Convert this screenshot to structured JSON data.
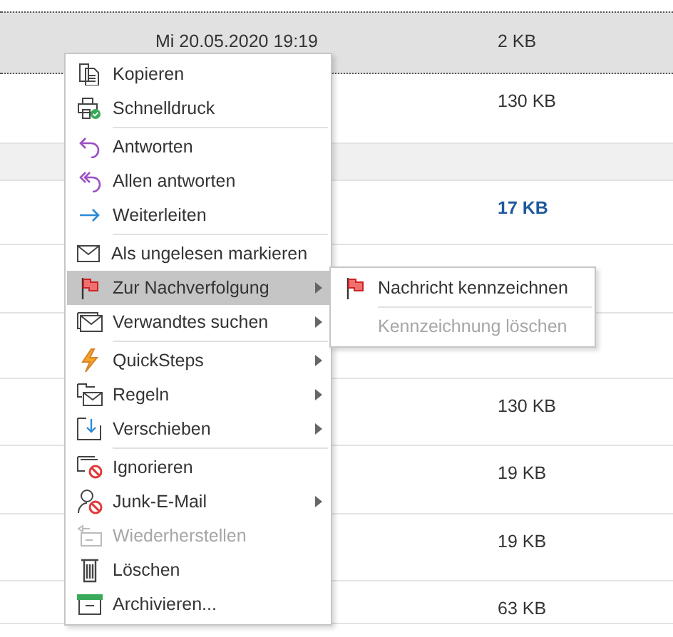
{
  "mail_list": {
    "rows": [
      {
        "date": "Mi 20.05.2020 19:19",
        "size": "2 KB",
        "kind": "selected"
      },
      {
        "size": "130 KB",
        "kind": "mail"
      },
      {
        "kind": "group"
      },
      {
        "size": "17 KB",
        "kind": "unread"
      },
      {
        "kind": "mail"
      },
      {
        "kind": "mail"
      },
      {
        "size": "130 KB",
        "kind": "mail"
      },
      {
        "size": "19 KB",
        "kind": "mail"
      },
      {
        "size": "19 KB",
        "kind": "mail"
      },
      {
        "size": "63 KB",
        "kind": "mail"
      }
    ]
  },
  "context_menu": {
    "items": [
      {
        "kind": "item",
        "label": "Kopieren",
        "selected": false,
        "disabled": false,
        "submenu": false
      },
      {
        "kind": "item",
        "label": "Schnelldruck",
        "selected": false,
        "disabled": false,
        "submenu": false
      },
      {
        "kind": "separator"
      },
      {
        "kind": "item",
        "label": "Antworten",
        "selected": false,
        "disabled": false,
        "submenu": false
      },
      {
        "kind": "item",
        "label": "Allen antworten",
        "selected": false,
        "disabled": false,
        "submenu": false
      },
      {
        "kind": "item",
        "label": "Weiterleiten",
        "selected": false,
        "disabled": false,
        "submenu": false
      },
      {
        "kind": "separator"
      },
      {
        "kind": "item",
        "label": "Als ungelesen markieren",
        "selected": false,
        "disabled": false,
        "submenu": false
      },
      {
        "kind": "item",
        "label": "Zur Nachverfolgung",
        "selected": true,
        "disabled": false,
        "submenu": true
      },
      {
        "kind": "item",
        "label": "Verwandtes suchen",
        "selected": false,
        "disabled": false,
        "submenu": true
      },
      {
        "kind": "separator"
      },
      {
        "kind": "item",
        "label": "QuickSteps",
        "selected": false,
        "disabled": false,
        "submenu": true
      },
      {
        "kind": "item",
        "label": "Regeln",
        "selected": false,
        "disabled": false,
        "submenu": true
      },
      {
        "kind": "item",
        "label": "Verschieben",
        "selected": false,
        "disabled": false,
        "submenu": true
      },
      {
        "kind": "separator"
      },
      {
        "kind": "item",
        "label": "Ignorieren",
        "selected": false,
        "disabled": false,
        "submenu": false
      },
      {
        "kind": "item",
        "label": "Junk-E-Mail",
        "selected": false,
        "disabled": false,
        "submenu": true
      },
      {
        "kind": "item",
        "label": "Wiederherstellen",
        "selected": false,
        "disabled": true,
        "submenu": false
      },
      {
        "kind": "item",
        "label": "Löschen",
        "selected": false,
        "disabled": false,
        "submenu": false
      },
      {
        "kind": "item",
        "label": "Archivieren...",
        "selected": false,
        "disabled": false,
        "submenu": false
      }
    ]
  },
  "submenu": {
    "items": [
      {
        "kind": "item",
        "label": "Nachricht kennzeichnen",
        "disabled": false,
        "icon": true
      },
      {
        "kind": "separator"
      },
      {
        "kind": "item",
        "label": "Kennzeichnung löschen",
        "disabled": true,
        "icon": false
      }
    ]
  }
}
